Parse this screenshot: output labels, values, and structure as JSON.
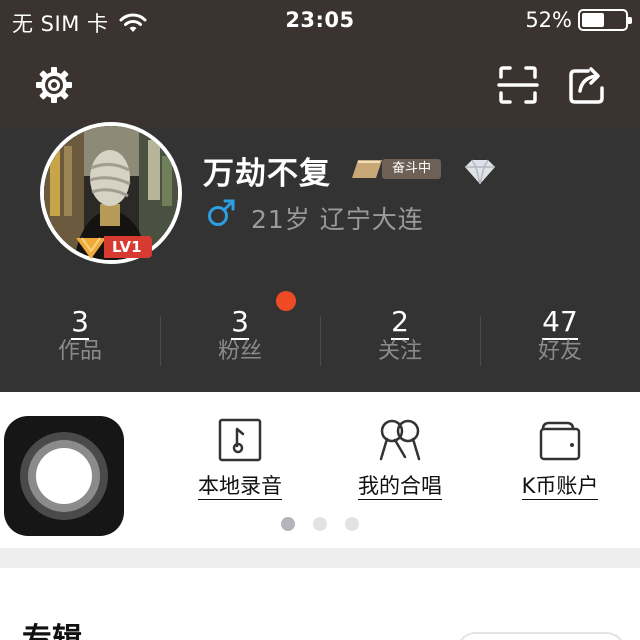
{
  "status_bar": {
    "carrier": "无 SIM 卡",
    "time": "23:05",
    "battery": "52%",
    "battery_level": 0.52
  },
  "navbar": {
    "left_icon": "gear-icon",
    "right_icons": [
      "scan-icon",
      "share-icon"
    ]
  },
  "profile": {
    "name": "万劫不复",
    "level": "LV1",
    "status_badge": "奋斗中",
    "gender_icon": "male-icon",
    "meta": "21岁 辽宁大连"
  },
  "stats": [
    {
      "value": "3",
      "label": "作品"
    },
    {
      "value": "3",
      "label": "粉丝"
    },
    {
      "value": "2",
      "label": "关注"
    },
    {
      "value": "47",
      "label": "好友"
    }
  ],
  "shortcuts": [
    {
      "icon": "music-file-icon",
      "label": "本地录音"
    },
    {
      "icon": "duet-mic-icon",
      "label": "我的合唱"
    },
    {
      "icon": "wallet-icon",
      "label": "K币账户"
    }
  ],
  "pager": {
    "current": 1,
    "total": 3
  },
  "section": {
    "title": "专辑"
  },
  "colors": {
    "header_dark": "#3b3330",
    "profile_bg": "#333333",
    "level_red": "#d63a31",
    "notify_dot": "#ee4a26",
    "gender_blue": "#2d9fe0"
  }
}
